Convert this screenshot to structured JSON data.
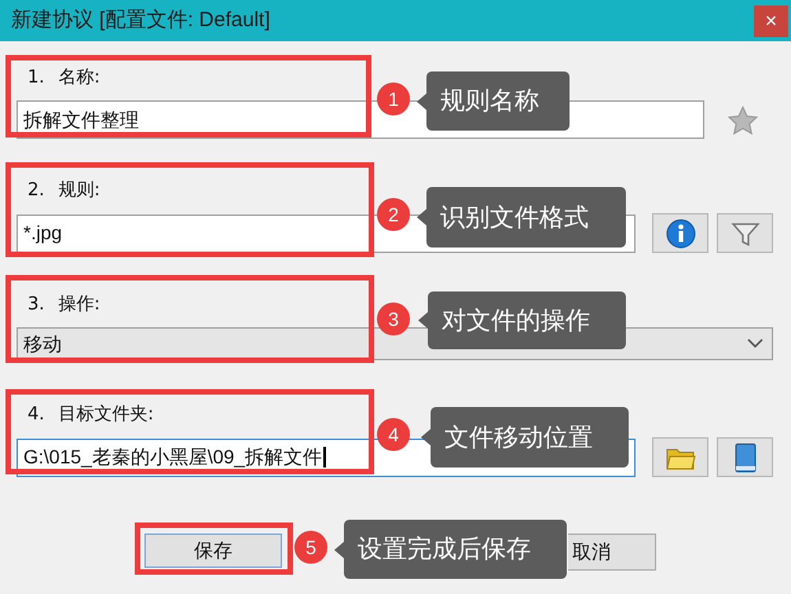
{
  "window": {
    "title": "新建协议 [配置文件: Default]",
    "close": "×"
  },
  "fields": [
    {
      "number": "1.",
      "label": "名称:",
      "kind": "text",
      "value": "拆解文件整理",
      "focused": false,
      "actions": [
        {
          "kind": "star"
        }
      ]
    },
    {
      "number": "2.",
      "label": "规则:",
      "kind": "text",
      "value": "*.jpg",
      "focused": false,
      "actions": [
        {
          "kind": "info"
        },
        {
          "kind": "filter"
        }
      ]
    },
    {
      "number": "3.",
      "label": "操作:",
      "kind": "select",
      "value": "移动",
      "focused": false
    },
    {
      "number": "4.",
      "label": "目标文件夹:",
      "kind": "text",
      "value": "G:\\015_老秦的小黑屋\\09_拆解文件",
      "focused": true,
      "actions": [
        {
          "kind": "folder"
        },
        {
          "kind": "book"
        }
      ]
    }
  ],
  "buttons": [
    {
      "label": "保存"
    },
    {
      "label": "取消"
    }
  ],
  "annotations": [
    {
      "number": "1",
      "text": "规则名称"
    },
    {
      "number": "2",
      "text": "识别文件格式"
    },
    {
      "number": "3",
      "text": "对文件的操作"
    },
    {
      "number": "4",
      "text": "文件移动位置"
    },
    {
      "number": "5",
      "text": "设置完成后保存"
    }
  ]
}
